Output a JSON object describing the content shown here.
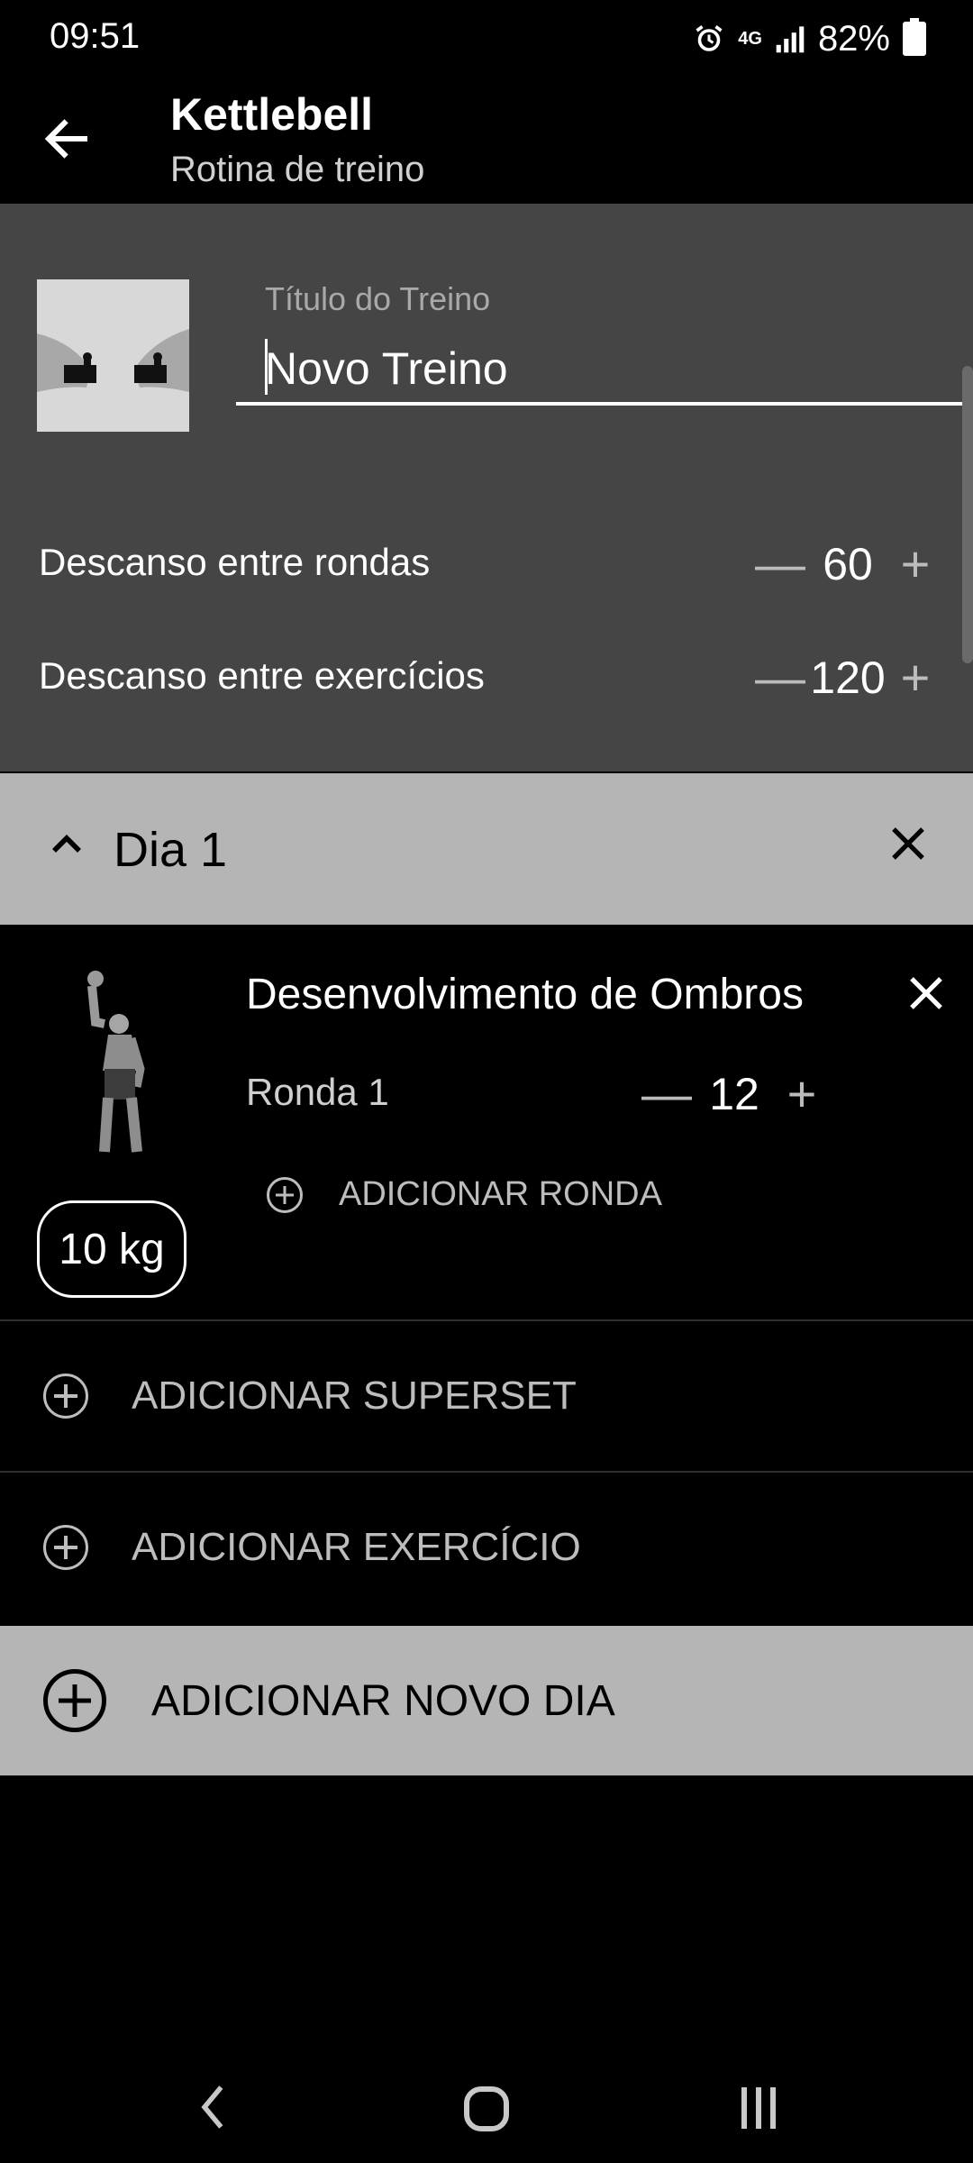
{
  "status": {
    "time": "09:51",
    "network": "4G",
    "battery": "82%"
  },
  "appbar": {
    "title": "Kettlebell",
    "subtitle": "Rotina de treino"
  },
  "workout": {
    "field_label": "Título do Treino",
    "name_value": "Novo Treino",
    "rest_rounds_label": "Descanso entre rondas",
    "rest_rounds_value": "60",
    "rest_exercises_label": "Descanso entre exercícios",
    "rest_exercises_value": "120"
  },
  "day": {
    "name": "Dia 1"
  },
  "exercise": {
    "name": "Desenvolvimento de Ombros",
    "round_label": "Ronda 1",
    "round_value": "12",
    "add_round": "ADICIONAR RONDA",
    "weight": "10 kg"
  },
  "actions": {
    "add_superset": "ADICIONAR SUPERSET",
    "add_exercise": "ADICIONAR EXERCÍCIO",
    "add_day": "ADICIONAR NOVO DIA"
  },
  "icons": {
    "back": "arrow-left-icon",
    "collapse": "chevron-up-icon",
    "close": "close-icon",
    "add": "plus-circle-icon",
    "minus": "minus-icon",
    "plus": "plus-icon"
  },
  "colors": {
    "panel": "#454545",
    "day_header": "#b5b5b5",
    "background": "#000000"
  }
}
